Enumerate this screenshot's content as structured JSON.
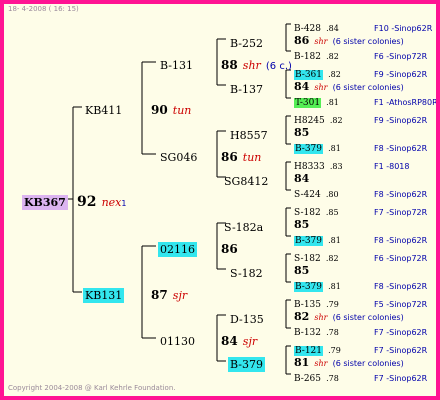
{
  "header": "18- 4-2008 ( 16: 15)",
  "footer": "Copyright 2004-2008 @ Karl Kehrle Foundation.",
  "root": {
    "name": "KB367",
    "score": "92",
    "tag": "nex",
    "sub": "1"
  },
  "gen1": [
    {
      "name": "KB411",
      "score": "90",
      "tag": "tun"
    },
    {
      "name": "KB131",
      "score": "87",
      "tag": "sjr"
    }
  ],
  "gen2": [
    {
      "name": "B-131",
      "score": "88",
      "tag": "shr",
      "note": "(6 c.)"
    },
    {
      "name": "SG046",
      "score": "86",
      "tag": "tun"
    },
    {
      "name": "02116",
      "score": "86",
      "tag": ""
    },
    {
      "name": "01130",
      "score": "84",
      "tag": "sjr"
    }
  ],
  "gen3": [
    {
      "name": "B-252",
      "score": "86",
      "tag": "shr",
      "sibs": "(6 sister colonies)",
      "upper": {
        "name": "B-428",
        "num": ".84",
        "origin": "F10 -Sinop62R"
      },
      "lower": {
        "name": "B-182",
        "num": ".82",
        "origin": "F6 -Sinop72R"
      }
    },
    {
      "name": "B-137",
      "score": "84",
      "tag": "shr",
      "sibs": "(6 sister colonies)",
      "upper": {
        "name": "B-361",
        "num": ".82",
        "origin": "F9 -Sinop62R"
      },
      "lower": {
        "name": "T-301",
        "num": ".81",
        "origin": "F1 -AthosRP80R"
      }
    },
    {
      "name": "H8557",
      "score": "85",
      "tag": "",
      "sibs": "",
      "upper": {
        "name": "H8245",
        "num": ".82",
        "origin": "F9 -Sinop62R"
      },
      "lower": {
        "name": "B-379",
        "num": ".81",
        "origin": "F8 -Sinop62R"
      }
    },
    {
      "name": "SG8412",
      "score": "84",
      "tag": "",
      "sibs": "",
      "upper": {
        "name": "H8333",
        "num": ".83",
        "origin": "F1 -8018"
      },
      "lower": {
        "name": "S-424",
        "num": ".80",
        "origin": "F8 -Sinop62R"
      }
    },
    {
      "name": "S-182a",
      "score": "85",
      "tag": "",
      "sibs": "",
      "upper": {
        "name": "S-182",
        "num": ".85",
        "origin": "F7 -Sinop72R"
      },
      "lower": {
        "name": "B-379",
        "num": ".81",
        "origin": "F8 -Sinop62R"
      }
    },
    {
      "name": "S-182",
      "score": "85",
      "tag": "",
      "sibs": "",
      "upper": {
        "name": "S-182",
        "num": ".82",
        "origin": "F6 -Sinop72R"
      },
      "lower": {
        "name": "B-379",
        "num": ".81",
        "origin": "F8 -Sinop62R"
      }
    },
    {
      "name": "D-135",
      "score": "82",
      "tag": "shr",
      "sibs": "(6 sister colonies)",
      "upper": {
        "name": "B-135",
        "num": ".79",
        "origin": "F5 -Sinop72R"
      },
      "lower": {
        "name": "B-132",
        "num": ".78",
        "origin": "F7 -Sinop62R"
      }
    },
    {
      "name": "B-379",
      "score": "81",
      "tag": "shr",
      "sibs": "(6 sister colonies)",
      "upper": {
        "name": "B-121",
        "num": ".79",
        "origin": "F7 -Sinop62R"
      },
      "lower": {
        "name": "B-265",
        "num": ".78",
        "origin": "F7 -Sinop62R"
      }
    }
  ]
}
